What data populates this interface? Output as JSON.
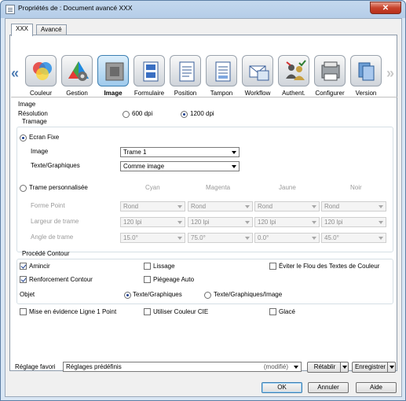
{
  "window": {
    "title": "Propriétés de : Document avancé XXX",
    "close_label": "✕"
  },
  "tabs": [
    {
      "label": "XXX",
      "active": true
    },
    {
      "label": "Avancé",
      "active": false
    }
  ],
  "categories": [
    {
      "label": "Couleur",
      "icon": "color-circles-icon"
    },
    {
      "label": "Gestion",
      "icon": "gear-color-icon"
    },
    {
      "label": "Image",
      "icon": "image-icon",
      "selected": true
    },
    {
      "label": "Formulaire",
      "icon": "form-icon"
    },
    {
      "label": "Position",
      "icon": "position-document-icon"
    },
    {
      "label": "Tampon",
      "icon": "stamp-icon"
    },
    {
      "label": "Workflow",
      "icon": "workflow-icon"
    },
    {
      "label": "Authent.",
      "icon": "users-auth-icon"
    },
    {
      "label": "Configurer",
      "icon": "printer-config-icon"
    },
    {
      "label": "Version",
      "icon": "version-icon"
    }
  ],
  "nav": {
    "prev": "«",
    "next": "»"
  },
  "image_section": {
    "heading": "Image",
    "resolution_label": "Résolution",
    "res_600": "600 dpi",
    "res_1200": "1200 dpi",
    "res_selected": "1200 dpi"
  },
  "tramage": {
    "heading": "Tramage",
    "ecran_fixe_label": "Ecran Fixe",
    "image_label": "Image",
    "image_value": "Trame 1",
    "text_label": "Texte/Graphiques",
    "text_value": "Comme image",
    "custom_label": "Trame personnalisée",
    "columns": [
      "Cyan",
      "Magenta",
      "Jaune",
      "Noir"
    ],
    "rows": [
      {
        "label": "Forme Point",
        "values": [
          "Rond",
          "Rond",
          "Rond",
          "Rond"
        ]
      },
      {
        "label": "Largeur de trame",
        "values": [
          "120 lpi",
          "120 lpi",
          "120 lpi",
          "120 lpi"
        ]
      },
      {
        "label": "Angle de trame",
        "values": [
          "15.0°",
          "75.0°",
          "0.0°",
          "45.0°"
        ]
      }
    ]
  },
  "contour": {
    "heading": "Procédé Contour",
    "amincir": "Amincir",
    "lissage": "Lissage",
    "eviter": "Éviter le Flou des Textes de Couleur",
    "renforcement": "Renforcement Contour",
    "piegeage": "Piégeage Auto",
    "objet_label": "Objet",
    "objet_opt1": "Texte/Graphiques",
    "objet_opt2": "Texte/Graphiques/Image"
  },
  "options": {
    "mise_en_evidence": "Mise en évidence Ligne 1 Point",
    "utiliser_cie": "Utiliser Couleur CIE",
    "glace": "Glacé"
  },
  "favorites": {
    "label": "Réglage favori",
    "value": "Réglages prédéfinis",
    "modified": "(modifié)",
    "retablir": "Rétablir",
    "enregistrer": "Enregistrer"
  },
  "dialog_buttons": {
    "ok": "OK",
    "annuler": "Annuler",
    "aide": "Aide"
  }
}
